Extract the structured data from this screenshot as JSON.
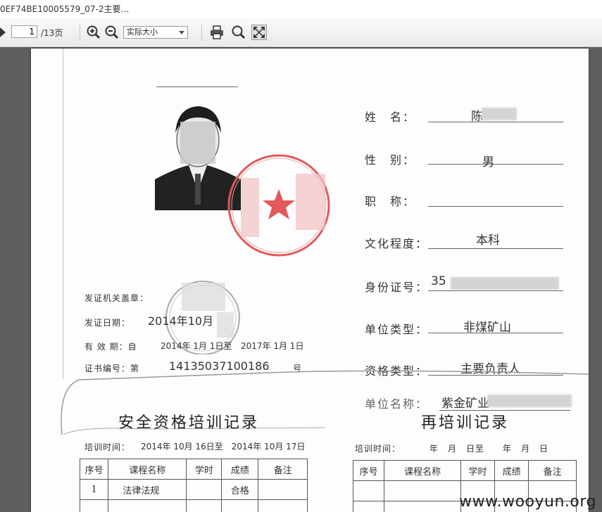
{
  "window": {
    "title": "0EF74BE10005579_07-2主要…"
  },
  "toolbar": {
    "page_current": "1",
    "page_total": "/13页",
    "zoom_value": "实际大小",
    "icons": [
      "prev-page-icon",
      "zoom-in-icon",
      "zoom-out-icon",
      "print-icon",
      "search-icon",
      "fullscreen-icon"
    ]
  },
  "certificate": {
    "fields": [
      {
        "label": "姓　名：",
        "value": "陈"
      },
      {
        "label": "性　别：",
        "value": "男"
      },
      {
        "label": "职　称：",
        "value": ""
      },
      {
        "label": "文化程度：",
        "value": "本科"
      },
      {
        "label": "身份证号：",
        "value": "35"
      },
      {
        "label": "单位类型：",
        "value": "非煤矿山"
      },
      {
        "label": "资格类型：",
        "value": "主要负责人"
      },
      {
        "label": "单位名称：",
        "value": "紫金矿业"
      }
    ],
    "issuer_label": "发证机关盖章：",
    "issue_date_label": "发证日期：",
    "issue_date_value": "2014年10月",
    "validity_label": "有 效 期：自",
    "validity_from": "2014年 1月 1日至",
    "validity_to": "2017年 1月 1日",
    "cert_no_label": "证书编号：第",
    "cert_no_value": "14135037100186",
    "cert_no_suffix": "号"
  },
  "records": {
    "left_title": "安全资格培训记录",
    "right_title": "再培训记录",
    "left_time_label": "培训时间：",
    "left_time_value": "2014年 10月 16日至　2014年 10月 17日",
    "right_time_label": "培训时间：",
    "right_time_value": "年　月　日至　　年　月　日",
    "headers": [
      "序号",
      "课程名称",
      "学时",
      "成绩",
      "备注"
    ],
    "left_rows": [
      [
        "1",
        "法律法规",
        "",
        "合格",
        ""
      ]
    ]
  },
  "watermark": "www.wooyun.org"
}
